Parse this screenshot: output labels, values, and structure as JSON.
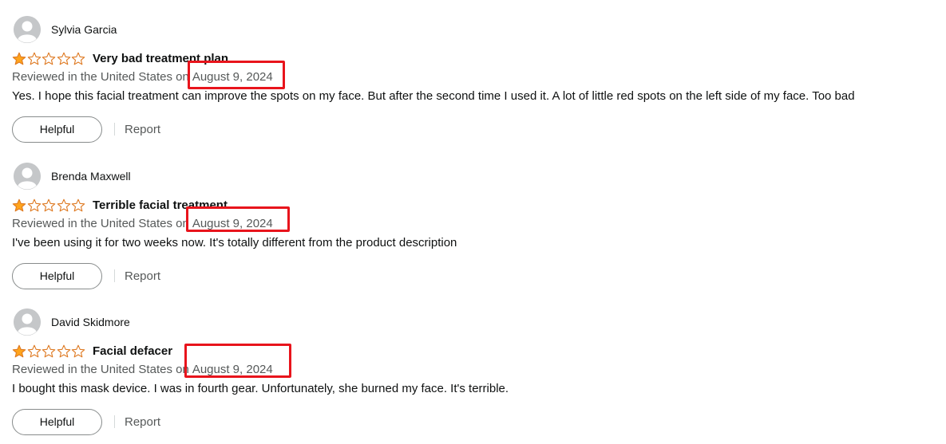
{
  "colors": {
    "star_fill": "#ffa41c",
    "star_outline": "#de7921",
    "highlight_box": "#e8141c",
    "meta_text": "#565959"
  },
  "icons": {
    "avatar": "default-user-avatar-icon",
    "star": "star-icon"
  },
  "reviews": [
    {
      "author": "Sylvia Garcia",
      "rating": 1,
      "max_rating": 5,
      "title": "Very bad treatment plan",
      "reviewed_prefix": "Reviewed in the United States on",
      "date": "August 9, 2024",
      "body": "Yes. I hope this facial treatment can improve the spots on my face. But after the second time I used it. A lot of little red spots on the left side of my face. Too bad",
      "helpful_label": "Helpful",
      "report_label": "Report"
    },
    {
      "author": "Brenda Maxwell",
      "rating": 1,
      "max_rating": 5,
      "title": "Terrible facial treatment",
      "reviewed_prefix": "Reviewed in the United States on",
      "date": "August 9, 2024",
      "body": "I've been using it for two weeks now. It's totally different from the product description",
      "helpful_label": "Helpful",
      "report_label": "Report"
    },
    {
      "author": "David Skidmore",
      "rating": 1,
      "max_rating": 5,
      "title": "Facial defacer",
      "reviewed_prefix": "Reviewed in the United States on",
      "date": "August 9, 2024",
      "body": "I bought this mask device. I was in fourth gear. Unfortunately, she burned my face. It's terrible.",
      "helpful_label": "Helpful",
      "report_label": "Report"
    }
  ]
}
